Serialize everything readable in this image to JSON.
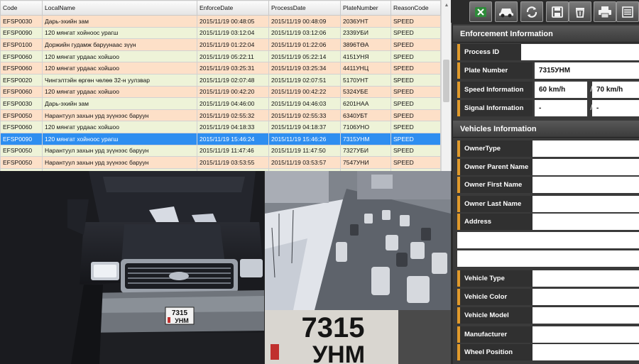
{
  "table": {
    "columns": [
      "Code",
      "LocalName",
      "EnforceDate",
      "ProcessDate",
      "PlateNumber",
      "ReasonCode"
    ],
    "rows": [
      {
        "code": "EFSP0030",
        "name": "Дарь-эхийн зам",
        "enforce": "2015/11/19 00:48:05",
        "process": "2015/11/19 00:48:09",
        "plate": "2036УНТ",
        "reason": "SPEED"
      },
      {
        "code": "EFSP0090",
        "name": "120 мянгат хойноос урагш",
        "enforce": "2015/11/19 03:12:04",
        "process": "2015/11/19 03:12:06",
        "plate": "2339УБИ",
        "reason": "SPEED"
      },
      {
        "code": "EFSP0100",
        "name": "Доржийн гудамж баруунаас зүүн",
        "enforce": "2015/11/19 01:22:04",
        "process": "2015/11/19 01:22:06",
        "plate": "3896ТӨА",
        "reason": "SPEED"
      },
      {
        "code": "EFSP0060",
        "name": "120 мянгат урдаас хойшоо",
        "enforce": "2015/11/19 05:22:11",
        "process": "2015/11/19 05:22:14",
        "plate": "4151УНЯ",
        "reason": "SPEED"
      },
      {
        "code": "EFSP0060",
        "name": "120 мянгат урдаас хойшоо",
        "enforce": "2015/11/19 03:25:31",
        "process": "2015/11/19 03:25:34",
        "plate": "4411УНЦ",
        "reason": "SPEED"
      },
      {
        "code": "EFSP0020",
        "name": "Чингэлтэйн өргөн чөлөө 32-н уулзвар",
        "enforce": "2015/11/19 02:07:48",
        "process": "2015/11/19 02:07:51",
        "plate": "5170УНТ",
        "reason": "SPEED"
      },
      {
        "code": "EFSP0060",
        "name": "120 мянгат урдаас хойшоо",
        "enforce": "2015/11/19 00:42:20",
        "process": "2015/11/19 00:42:22",
        "plate": "5324УБЕ",
        "reason": "SPEED"
      },
      {
        "code": "EFSP0030",
        "name": "Дарь-эхийн зам",
        "enforce": "2015/11/19 04:46:00",
        "process": "2015/11/19 04:46:03",
        "plate": "6201НАА",
        "reason": "SPEED"
      },
      {
        "code": "EFSP0050",
        "name": "Нарантуул захын урд зүүнээс баруун",
        "enforce": "2015/11/19 02:55:32",
        "process": "2015/11/19 02:55:33",
        "plate": "6340УБТ",
        "reason": "SPEED"
      },
      {
        "code": "EFSP0060",
        "name": "120 мянгат урдаас хойшоо",
        "enforce": "2015/11/19 04:18:33",
        "process": "2015/11/19 04:18:37",
        "plate": "7106УНО",
        "reason": "SPEED"
      },
      {
        "code": "EFSP0090",
        "name": "120 мянгат хойноос урагш",
        "enforce": "2015/11/19 15:46:24",
        "process": "2015/11/19 15:46:26",
        "plate": "7315УНМ",
        "reason": "SPEED",
        "selected": true
      },
      {
        "code": "EFSP0050",
        "name": "Нарантуул захын урд зүүнээс баруун",
        "enforce": "2015/11/19 11:47:46",
        "process": "2015/11/19 11:47:50",
        "plate": "7327УБИ",
        "reason": "SPEED"
      },
      {
        "code": "EFSP0050",
        "name": "Нарантуул захын урд зүүнээс баруун",
        "enforce": "2015/11/19 03:53:55",
        "process": "2015/11/19 03:53:57",
        "plate": "7547УНИ",
        "reason": "SPEED"
      },
      {
        "code": "",
        "name": "",
        "enforce": "",
        "process": "",
        "plate": "",
        "reason": ""
      }
    ]
  },
  "images": {
    "car_plate_top": "7315",
    "car_plate_bottom": "УНМ",
    "plate_crop_top": "7315",
    "plate_crop_bottom": "УНМ"
  },
  "toolbar": {
    "icons": [
      "excel-icon",
      "car-icon",
      "refresh-icon",
      "save-icon",
      "trash-icon",
      "printer-icon",
      "list-icon"
    ],
    "colors": {
      "excel": "#2e8b3a",
      "button": "#5a5a5a"
    }
  },
  "enforcement": {
    "title": "Enforcement Information",
    "process_id_label": "Process ID",
    "process_id_value": "",
    "plate_label": "Plate Number",
    "plate_value": "7315УНМ",
    "speed_label": "Speed Information",
    "speed_value1": "60 km/h",
    "speed_value2": "70 km/h",
    "signal_label": "Signal Information",
    "signal_value1": "-",
    "signal_value2": "-",
    "separator": "/"
  },
  "vehicles": {
    "title": "Vehicles Information",
    "owner_type_label": "OwnerType",
    "owner_parent_label": "Owner Parent Name",
    "owner_first_label": "Owner First Name",
    "owner_last_label": "Owner Last Name",
    "address_label": "Address",
    "vehicle_type_label": "Vehicle Type",
    "vehicle_color_label": "Vehicle Color",
    "vehicle_model_label": "Vehicle Model",
    "manufacturer_label": "Manufacturer",
    "wheel_position_label": "Wheel Position"
  },
  "colors": {
    "accent": "#e09a2b",
    "selection": "#2e8ef0",
    "row_peach": "#fde0c8",
    "row_green": "#eef3d8"
  }
}
